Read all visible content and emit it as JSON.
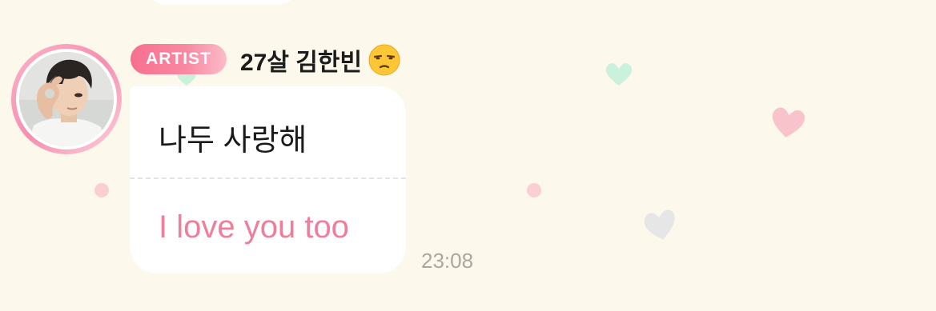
{
  "message": {
    "badge": "ARTIST",
    "sender_name": "27살 김한빈",
    "sender_emoji": "unamused-face-emoji",
    "original_text": "나두 사랑해",
    "translated_text": "I love you too",
    "time": "23:08"
  },
  "colors": {
    "background": "#fdf8ec",
    "badge_gradient_start": "#f76f8e",
    "translation_text": "#ee7e9a",
    "time_text": "#aaa7a2",
    "heart_pink": "#f9c3cc",
    "heart_mint": "#c9f1dc",
    "heart_gray": "#e6e6e6"
  }
}
